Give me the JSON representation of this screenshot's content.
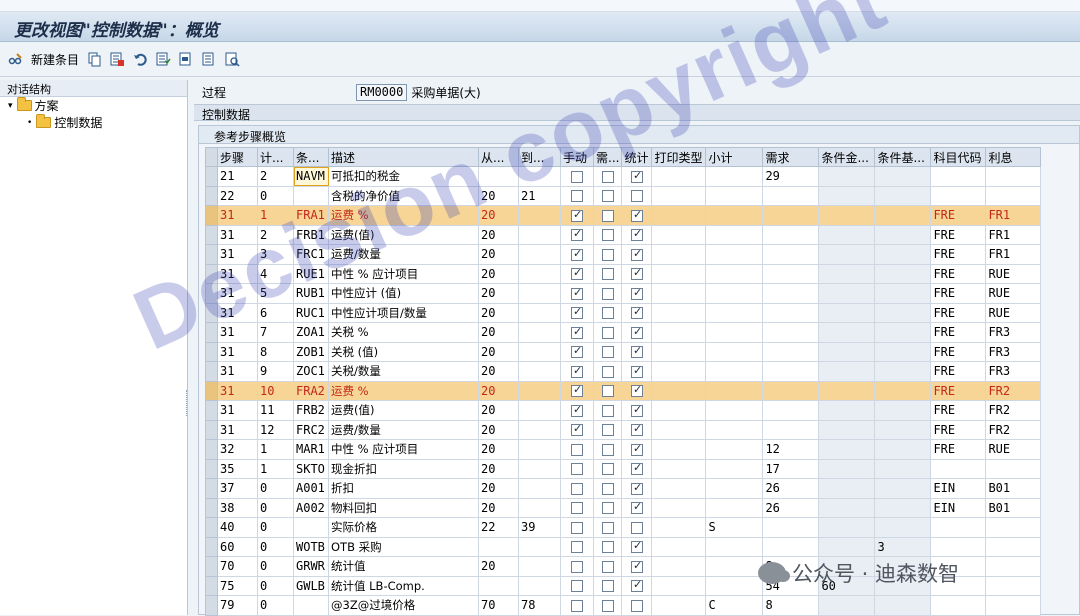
{
  "title": "更改视图\"控制数据\"：概览",
  "toolbar": {
    "new_entry_label": "新建条目"
  },
  "left_pane": {
    "header": "对话结构",
    "tree": [
      {
        "label": "方案",
        "level": 0
      },
      {
        "label": "控制数据",
        "level": 1
      }
    ]
  },
  "procedure": {
    "label": "过程",
    "value": "RM0000",
    "description": "采购单据(大)"
  },
  "section_title": "控制数据",
  "subsection_title": "参考步骤概览",
  "columns": [
    "步骤",
    "计...",
    "条...",
    "描述",
    "从...",
    "到...",
    "手动",
    "需...",
    "统计",
    "打印类型",
    "小计",
    "需求",
    "条件金...",
    "条件基...",
    "科目代码",
    "利息"
  ],
  "rows": [
    {
      "step": "21",
      "counter": "2",
      "ctype": "NAVM",
      "desc": "可抵扣的税金",
      "from": "",
      "to": "",
      "manual": false,
      "required": false,
      "stat": true,
      "print": "",
      "subtotal": "",
      "req": "29",
      "condval": "",
      "condbase": "",
      "acct": "",
      "accrual": "",
      "highlight": false
    },
    {
      "step": "22",
      "counter": "0",
      "ctype": "",
      "desc": "含税的净价值",
      "from": "20",
      "to": "21",
      "manual": false,
      "required": false,
      "stat": false,
      "print": "",
      "subtotal": "",
      "req": "",
      "condval": "",
      "condbase": "",
      "acct": "",
      "accrual": "",
      "highlight": false
    },
    {
      "step": "31",
      "counter": "1",
      "ctype": "FRA1",
      "desc": "运费 %",
      "from": "20",
      "to": "",
      "manual": true,
      "required": false,
      "stat": true,
      "print": "",
      "subtotal": "",
      "req": "",
      "condval": "",
      "condbase": "",
      "acct": "FRE",
      "accrual": "FR1",
      "highlight": true
    },
    {
      "step": "31",
      "counter": "2",
      "ctype": "FRB1",
      "desc": "运费(值)",
      "from": "20",
      "to": "",
      "manual": true,
      "required": false,
      "stat": true,
      "print": "",
      "subtotal": "",
      "req": "",
      "condval": "",
      "condbase": "",
      "acct": "FRE",
      "accrual": "FR1",
      "highlight": false
    },
    {
      "step": "31",
      "counter": "3",
      "ctype": "FRC1",
      "desc": "运费/数量",
      "from": "20",
      "to": "",
      "manual": true,
      "required": false,
      "stat": true,
      "print": "",
      "subtotal": "",
      "req": "",
      "condval": "",
      "condbase": "",
      "acct": "FRE",
      "accrual": "FR1",
      "highlight": false
    },
    {
      "step": "31",
      "counter": "4",
      "ctype": "RUE1",
      "desc": "中性 % 应计项目",
      "from": "20",
      "to": "",
      "manual": true,
      "required": false,
      "stat": true,
      "print": "",
      "subtotal": "",
      "req": "",
      "condval": "",
      "condbase": "",
      "acct": "FRE",
      "accrual": "RUE",
      "highlight": false
    },
    {
      "step": "31",
      "counter": "5",
      "ctype": "RUB1",
      "desc": "中性应计 (值)",
      "from": "20",
      "to": "",
      "manual": true,
      "required": false,
      "stat": true,
      "print": "",
      "subtotal": "",
      "req": "",
      "condval": "",
      "condbase": "",
      "acct": "FRE",
      "accrual": "RUE",
      "highlight": false
    },
    {
      "step": "31",
      "counter": "6",
      "ctype": "RUC1",
      "desc": "中性应计项目/数量",
      "from": "20",
      "to": "",
      "manual": true,
      "required": false,
      "stat": true,
      "print": "",
      "subtotal": "",
      "req": "",
      "condval": "",
      "condbase": "",
      "acct": "FRE",
      "accrual": "RUE",
      "highlight": false
    },
    {
      "step": "31",
      "counter": "7",
      "ctype": "ZOA1",
      "desc": "关税 %",
      "from": "20",
      "to": "",
      "manual": true,
      "required": false,
      "stat": true,
      "print": "",
      "subtotal": "",
      "req": "",
      "condval": "",
      "condbase": "",
      "acct": "FRE",
      "accrual": "FR3",
      "highlight": false
    },
    {
      "step": "31",
      "counter": "8",
      "ctype": "ZOB1",
      "desc": "关税 (值)",
      "from": "20",
      "to": "",
      "manual": true,
      "required": false,
      "stat": true,
      "print": "",
      "subtotal": "",
      "req": "",
      "condval": "",
      "condbase": "",
      "acct": "FRE",
      "accrual": "FR3",
      "highlight": false
    },
    {
      "step": "31",
      "counter": "9",
      "ctype": "ZOC1",
      "desc": "关税/数量",
      "from": "20",
      "to": "",
      "manual": true,
      "required": false,
      "stat": true,
      "print": "",
      "subtotal": "",
      "req": "",
      "condval": "",
      "condbase": "",
      "acct": "FRE",
      "accrual": "FR3",
      "highlight": false
    },
    {
      "step": "31",
      "counter": "10",
      "ctype": "FRA2",
      "desc": "运费 %",
      "from": "20",
      "to": "",
      "manual": true,
      "required": false,
      "stat": true,
      "print": "",
      "subtotal": "",
      "req": "",
      "condval": "",
      "condbase": "",
      "acct": "FRE",
      "accrual": "FR2",
      "highlight": true
    },
    {
      "step": "31",
      "counter": "11",
      "ctype": "FRB2",
      "desc": "运费(值)",
      "from": "20",
      "to": "",
      "manual": true,
      "required": false,
      "stat": true,
      "print": "",
      "subtotal": "",
      "req": "",
      "condval": "",
      "condbase": "",
      "acct": "FRE",
      "accrual": "FR2",
      "highlight": false
    },
    {
      "step": "31",
      "counter": "12",
      "ctype": "FRC2",
      "desc": "运费/数量",
      "from": "20",
      "to": "",
      "manual": true,
      "required": false,
      "stat": true,
      "print": "",
      "subtotal": "",
      "req": "",
      "condval": "",
      "condbase": "",
      "acct": "FRE",
      "accrual": "FR2",
      "highlight": false
    },
    {
      "step": "32",
      "counter": "1",
      "ctype": "MAR1",
      "desc": "中性 % 应计项目",
      "from": "20",
      "to": "",
      "manual": false,
      "required": false,
      "stat": true,
      "print": "",
      "subtotal": "",
      "req": "12",
      "condval": "",
      "condbase": "",
      "acct": "FRE",
      "accrual": "RUE",
      "highlight": false
    },
    {
      "step": "35",
      "counter": "1",
      "ctype": "SKTO",
      "desc": "现金折扣",
      "from": "20",
      "to": "",
      "manual": false,
      "required": false,
      "stat": true,
      "print": "",
      "subtotal": "",
      "req": "17",
      "condval": "",
      "condbase": "",
      "acct": "",
      "accrual": "",
      "highlight": false
    },
    {
      "step": "37",
      "counter": "0",
      "ctype": "A001",
      "desc": "折扣",
      "from": "20",
      "to": "",
      "manual": false,
      "required": false,
      "stat": true,
      "print": "",
      "subtotal": "",
      "req": "26",
      "condval": "",
      "condbase": "",
      "acct": "EIN",
      "accrual": "B01",
      "highlight": false
    },
    {
      "step": "38",
      "counter": "0",
      "ctype": "A002",
      "desc": "物料回扣",
      "from": "20",
      "to": "",
      "manual": false,
      "required": false,
      "stat": true,
      "print": "",
      "subtotal": "",
      "req": "26",
      "condval": "",
      "condbase": "",
      "acct": "EIN",
      "accrual": "B01",
      "highlight": false
    },
    {
      "step": "40",
      "counter": "0",
      "ctype": "",
      "desc": "实际价格",
      "from": "22",
      "to": "39",
      "manual": false,
      "required": false,
      "stat": false,
      "print": "",
      "subtotal": "S",
      "req": "",
      "condval": "",
      "condbase": "",
      "acct": "",
      "accrual": "",
      "highlight": false
    },
    {
      "step": "60",
      "counter": "0",
      "ctype": "WOTB",
      "desc": "OTB 采购",
      "from": "",
      "to": "",
      "manual": false,
      "required": false,
      "stat": true,
      "print": "",
      "subtotal": "",
      "req": "",
      "condval": "",
      "condbase": "3",
      "acct": "",
      "accrual": "",
      "highlight": false
    },
    {
      "step": "70",
      "counter": "0",
      "ctype": "GRWR",
      "desc": "统计值",
      "from": "20",
      "to": "",
      "manual": false,
      "required": false,
      "stat": true,
      "print": "",
      "subtotal": "",
      "req": "8",
      "condval": "",
      "condbase": "",
      "acct": "",
      "accrual": "",
      "highlight": false
    },
    {
      "step": "75",
      "counter": "0",
      "ctype": "GWLB",
      "desc": "统计值 LB-Comp.",
      "from": "",
      "to": "",
      "manual": false,
      "required": false,
      "stat": true,
      "print": "",
      "subtotal": "",
      "req": "54",
      "condval": "60",
      "condbase": "",
      "acct": "",
      "accrual": "",
      "highlight": false
    },
    {
      "step": "79",
      "counter": "0",
      "ctype": "",
      "desc": "@3Z@过境价格",
      "from": "70",
      "to": "78",
      "manual": false,
      "required": false,
      "stat": false,
      "print": "",
      "subtotal": "C",
      "req": "8",
      "condval": "",
      "condbase": "",
      "acct": "",
      "accrual": "",
      "highlight": false
    }
  ],
  "watermark": "Decision copyright",
  "footer_brand": "公众号 · 迪森数智"
}
